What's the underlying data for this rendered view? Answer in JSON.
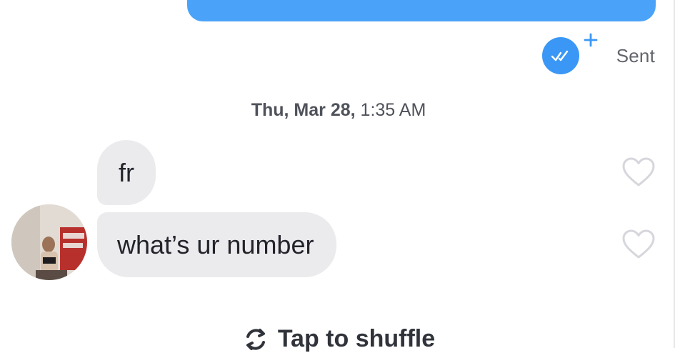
{
  "status": {
    "sent_label": "Sent"
  },
  "divider": {
    "day": "Thu, Mar 28,",
    "time": "1:35 AM"
  },
  "messages": [
    {
      "text": "fr"
    },
    {
      "text": "what’s ur number"
    }
  ],
  "footer": {
    "shuffle_label": "Tap to shuffle"
  },
  "colors": {
    "sent_bubble": "#4aa3f8",
    "read_badge": "#3b97f5",
    "received_bubble": "#ebebee",
    "heart_outline": "#d6d7dc"
  },
  "icons": {
    "read_receipt": "double-check-icon",
    "boost": "plus-icon",
    "like": "heart-outline-icon",
    "shuffle": "refresh-icon"
  }
}
